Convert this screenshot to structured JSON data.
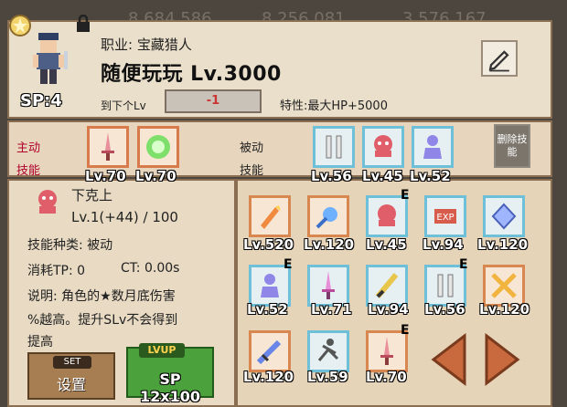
{
  "background": {
    "numbers": [
      "8,684,586",
      "8,256,081",
      "3,576,167"
    ]
  },
  "header": {
    "job": "职业: 宝藏猎人",
    "name": "随便玩玩 Lv.3000",
    "sp": "SP:4",
    "next_lv_label": "到下个Lv",
    "next_lv_value": "-1",
    "trait": "特性:最大HP+5000"
  },
  "labels": {
    "active_1": "主动",
    "active_2": "技能",
    "passive_1": "被动",
    "passive_2": "技能",
    "reset": "删除技能"
  },
  "equipped_active": [
    {
      "icon": "sword-icon",
      "lv": "Lv.70"
    },
    {
      "icon": "green-orb-icon",
      "lv": "Lv.70"
    }
  ],
  "equipped_passive": [
    {
      "icon": "double-blade-icon",
      "lv": "Lv.56"
    },
    {
      "icon": "octopus-icon",
      "lv": "Lv.45"
    },
    {
      "icon": "person-icon",
      "lv": "Lv.52"
    }
  ],
  "detail": {
    "name": "下克上",
    "level": "Lv.1(+44) / 100",
    "type": "技能种类: 被动",
    "tp": "消耗TP: 0",
    "ct": "CT: 0.00s",
    "desc_1": "说明: 角色的★数月底伤害",
    "desc_2": "%越高。提升SLv不会得到",
    "desc_3": "提高"
  },
  "buttons": {
    "set_tag": "SET",
    "set": "设置",
    "lvup_tag": "LVUP",
    "lvup": "SP 12x100"
  },
  "skills": [
    {
      "icon": "flame-icon",
      "lv": "Lv.520",
      "e": ""
    },
    {
      "icon": "comet-icon",
      "lv": "Lv.120",
      "e": ""
    },
    {
      "icon": "octopus-icon",
      "lv": "Lv.45",
      "e": "E"
    },
    {
      "icon": "exp-icon",
      "lv": "Lv.94",
      "e": ""
    },
    {
      "icon": "diamond-icon",
      "lv": "Lv.120",
      "e": ""
    },
    {
      "icon": "person-icon",
      "lv": "Lv.52",
      "e": "E"
    },
    {
      "icon": "sword-icon",
      "lv": "Lv.71",
      "e": ""
    },
    {
      "icon": "feather-icon",
      "lv": "Lv.94",
      "e": ""
    },
    {
      "icon": "double-blade-icon",
      "lv": "Lv.56",
      "e": "E"
    },
    {
      "icon": "cross-blades-icon",
      "lv": "Lv.120",
      "e": ""
    },
    {
      "icon": "blue-sword-icon",
      "lv": "Lv.120",
      "e": ""
    },
    {
      "icon": "fighter-icon",
      "lv": "Lv.59",
      "e": ""
    },
    {
      "icon": "sword-icon",
      "lv": "Lv.70",
      "e": "E"
    }
  ]
}
